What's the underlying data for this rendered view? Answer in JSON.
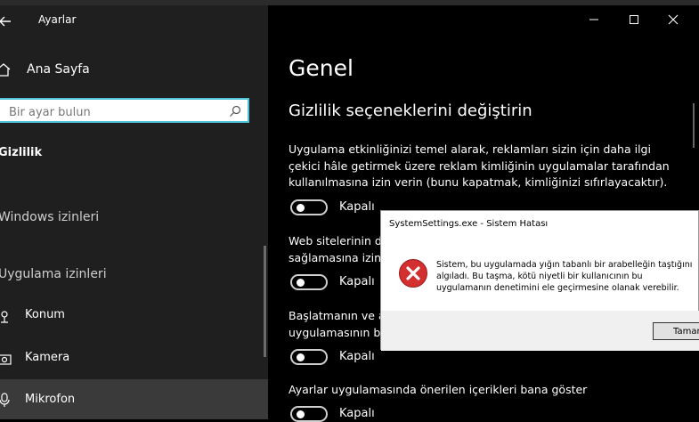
{
  "sidebar": {
    "app_title": "Ayarlar",
    "home_label": "Ana Sayfa",
    "search_placeholder": "Bir ayar bulun",
    "section_title": "Gizlilik",
    "windows_permissions": "Windows izinleri",
    "app_permissions": "Uygulama izinleri",
    "items": [
      {
        "label": "Konum",
        "icon": "location-icon"
      },
      {
        "label": "Kamera",
        "icon": "camera-icon"
      },
      {
        "label": "Mikrofon",
        "icon": "microphone-icon",
        "selected": true
      }
    ]
  },
  "main": {
    "title": "Genel",
    "subtitle": "Gizlilik seçeneklerini değiştirin",
    "settings": [
      {
        "lines": [
          "Uygulama etkinliğinizi temel alarak, reklamları sizin için daha ilgi",
          "çekici hâle getirmek üzere reklam kimliğinin uygulamalar tarafından",
          "kullanılmasına izin verin (bunu kapatmak, kimliğinizi sıfırlayacaktır)."
        ],
        "toggle": "Kapalı"
      },
      {
        "lines": [
          "Web sitelerinin d",
          "sağlamasına izin"
        ],
        "toggle": "Kapalı"
      },
      {
        "lines": [
          "Başlatmanın ve a",
          "uygulamasının b"
        ],
        "toggle": "Kapalı"
      },
      {
        "lines": [
          "Ayarlar uygulamasında önerilen içerikleri bana göster"
        ],
        "toggle": "Kapalı"
      }
    ]
  },
  "dialog": {
    "title": "SystemSettings.exe - Sistem Hatası",
    "message_lines": [
      "Sistem, bu uygulamada yığın tabanlı bir arabelleğin taştığını",
      "algıladı. Bu taşma, kötü niyetli bir kullanıcının bu",
      "uygulamanın denetimini ele geçirmesine olanak verebilir."
    ],
    "ok_label": "Tamam"
  },
  "colors": {
    "accent": "#4ec3d8",
    "error": "#d32f2f"
  }
}
